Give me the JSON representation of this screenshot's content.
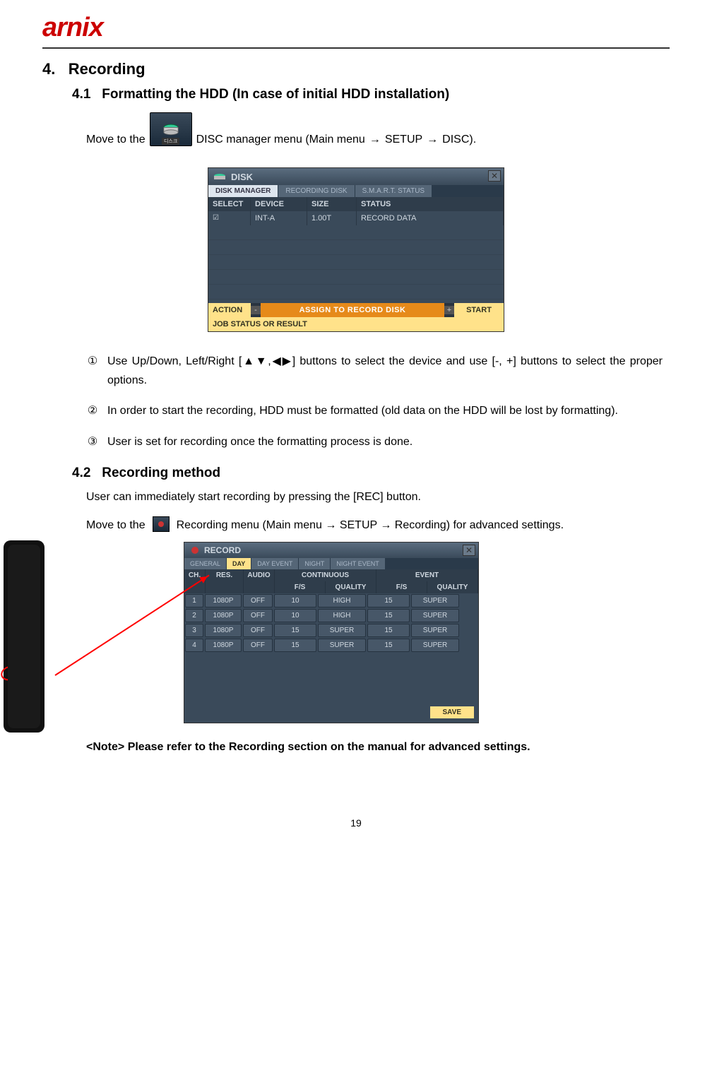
{
  "logo": "arnix",
  "section": {
    "num": "4.",
    "title": "Recording",
    "sub1": {
      "num": "4.1",
      "title": "Formatting  the  HDD  (In case of initial HDD installation)",
      "move_prefix": "Move to the",
      "icon_label": "디스크",
      "move_suffix_a": "  DISC manager menu (Main menu ",
      "arrow": "→",
      "move_suffix_b": " SETUP ",
      "move_suffix_c": " DISC).",
      "steps": [
        "Use  Up/Down,  Left/Right  [▲▼,◀▶]  buttons  to  select  the  device  and  use  [-,  +]  buttons  to select the proper options.",
        "In order to start the recording, HDD must be formatted (old data on the HDD will be lost by formatting).",
        "User is set for recording once the formatting process is done."
      ],
      "markers": [
        "①",
        "②",
        "③"
      ]
    },
    "sub2": {
      "num": "4.2",
      "title": "Recording  method",
      "line1": "User can immediately start recording by pressing the [REC] button.",
      "move_prefix": "Move to the",
      "move_suffix": " Recording menu (Main menu → SETUP → Recording) for advanced settings."
    },
    "note": "<Note> Please refer to the Recording section on the manual for advanced settings."
  },
  "disk_window": {
    "title": "DISK",
    "tabs": [
      "DISK MANAGER",
      "RECORDING DISK",
      "S.M.A.R.T. STATUS"
    ],
    "headers": [
      "SELECT",
      "DEVICE",
      "SIZE",
      "STATUS"
    ],
    "row": {
      "check": "☑",
      "device": "INT-A",
      "size": "1.00T",
      "status": "RECORD DATA"
    },
    "action_label": "ACTION",
    "assign": "ASSIGN TO RECORD DISK",
    "start": "START",
    "job": "JOB STATUS OR RESULT"
  },
  "record_window": {
    "title": "RECORD",
    "tabs": [
      "GENERAL",
      "DAY",
      "DAY EVENT",
      "NIGHT",
      "NIGHT EVENT"
    ],
    "active_tab": 1,
    "group_headers": [
      "CONTINUOUS",
      "EVENT"
    ],
    "sub_headers": [
      "CH.",
      "RES.",
      "AUDIO",
      "F/S",
      "QUALITY",
      "F/S",
      "QUALITY"
    ],
    "rows": [
      {
        "ch": "1",
        "res": "1080P",
        "audio": "OFF",
        "cfs": "10",
        "cq": "HIGH",
        "efs": "15",
        "eq": "SUPER"
      },
      {
        "ch": "2",
        "res": "1080P",
        "audio": "OFF",
        "cfs": "10",
        "cq": "HIGH",
        "efs": "15",
        "eq": "SUPER"
      },
      {
        "ch": "3",
        "res": "1080P",
        "audio": "OFF",
        "cfs": "15",
        "cq": "SUPER",
        "efs": "15",
        "eq": "SUPER"
      },
      {
        "ch": "4",
        "res": "1080P",
        "audio": "OFF",
        "cfs": "15",
        "cq": "SUPER",
        "efs": "15",
        "eq": "SUPER"
      }
    ],
    "save": "SAVE"
  },
  "page_number": "19"
}
